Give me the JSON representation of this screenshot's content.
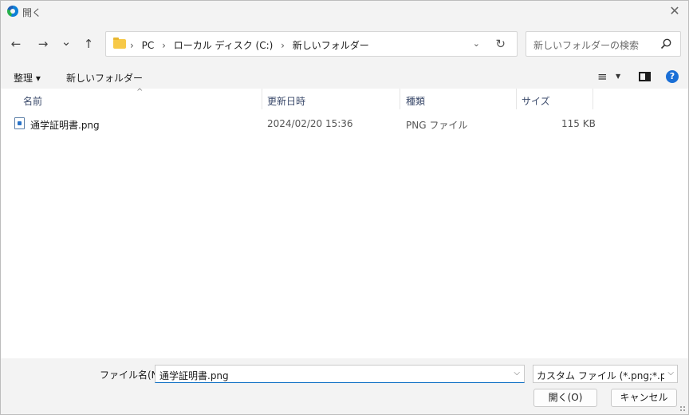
{
  "window": {
    "title": "開く",
    "close_glyph": "✕"
  },
  "nav": {
    "back_glyph": "←",
    "forward_glyph": "→",
    "recent_glyph": "⌄",
    "up_glyph": "↑"
  },
  "address": {
    "crumbs": [
      "PC",
      "ローカル ディスク (C:)",
      "新しいフォルダー"
    ],
    "separator": "›",
    "dropdown_glyph": "⌄",
    "refresh_glyph": "↻"
  },
  "search": {
    "placeholder": "新しいフォルダーの検索"
  },
  "toolbar": {
    "organize_label": "整理 ▾",
    "new_folder_label": "新しいフォルダー",
    "view_glyph": "≡",
    "view_arrow": "▼",
    "help_glyph": "?"
  },
  "columns": {
    "name": "名前",
    "modified": "更新日時",
    "type": "種類",
    "size": "サイズ",
    "sort_glyph": "^"
  },
  "files": [
    {
      "name": "通学証明書.png",
      "modified": "2024/02/20 15:36",
      "type": "PNG ファイル",
      "size": "115 KB"
    }
  ],
  "bottom": {
    "filename_label": "ファイル名(N):",
    "filename_value": "通学証明書.png",
    "filename_drop_glyph": "⌵",
    "filetype_value": "カスタム ファイル (*.png;*.pjp;*.jpg;*.jpeg)",
    "filetype_drop_glyph": "⌵",
    "open_label": "開く(O)",
    "cancel_label": "キャンセル"
  },
  "colors": {
    "accent": "#0067c0",
    "folder": "#f7c948",
    "help": "#1a6fd6"
  }
}
